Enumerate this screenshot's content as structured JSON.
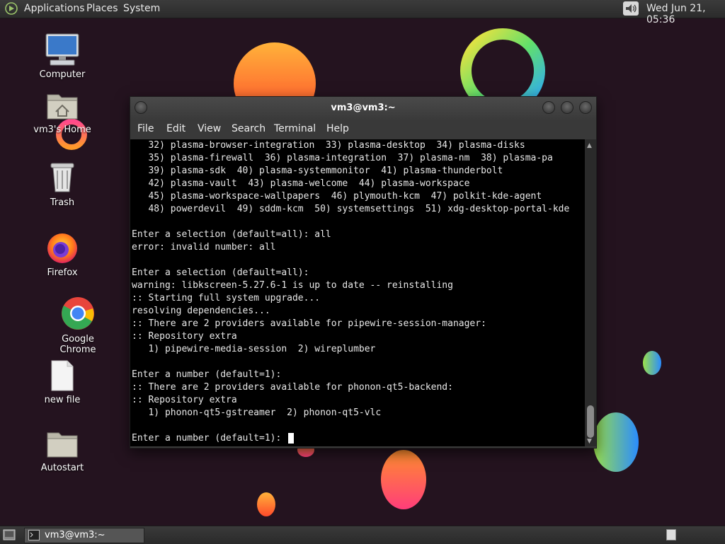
{
  "top_panel": {
    "menus": [
      "Applications",
      "Places",
      "System"
    ],
    "clock": "Wed Jun 21, 05:36"
  },
  "desktop_icons": [
    {
      "label": "Computer",
      "icon": "computer-icon"
    },
    {
      "label": "vm3's Home",
      "icon": "home-folder-icon"
    },
    {
      "label": "Trash",
      "icon": "trash-icon"
    },
    {
      "label": "Firefox",
      "icon": "firefox-icon"
    },
    {
      "label": "Google Chrome",
      "icon": "chrome-icon"
    },
    {
      "label": "new file",
      "icon": "file-icon"
    },
    {
      "label": "Autostart",
      "icon": "folder-icon"
    }
  ],
  "terminal": {
    "title": "vm3@vm3:~",
    "menu": [
      "File",
      "Edit",
      "View",
      "Search",
      "Terminal",
      "Help"
    ],
    "lines": [
      "   32) plasma-browser-integration  33) plasma-desktop  34) plasma-disks",
      "   35) plasma-firewall  36) plasma-integration  37) plasma-nm  38) plasma-pa",
      "   39) plasma-sdk  40) plasma-systemmonitor  41) plasma-thunderbolt",
      "   42) plasma-vault  43) plasma-welcome  44) plasma-workspace",
      "   45) plasma-workspace-wallpapers  46) plymouth-kcm  47) polkit-kde-agent",
      "   48) powerdevil  49) sddm-kcm  50) systemsettings  51) xdg-desktop-portal-kde",
      "",
      "Enter a selection (default=all): all",
      "error: invalid number: all",
      "",
      "Enter a selection (default=all):",
      "warning: libkscreen-5.27.6-1 is up to date -- reinstalling",
      ":: Starting full system upgrade...",
      "resolving dependencies...",
      ":: There are 2 providers available for pipewire-session-manager:",
      ":: Repository extra",
      "   1) pipewire-media-session  2) wireplumber",
      "",
      "Enter a number (default=1):",
      ":: There are 2 providers available for phonon-qt5-backend:",
      ":: Repository extra",
      "   1) phonon-qt5-gstreamer  2) phonon-qt5-vlc",
      ""
    ],
    "prompt": "Enter a number (default=1): "
  },
  "taskbar": {
    "window_button": "vm3@vm3:~"
  },
  "colors": {
    "desktop_background": "#24131f",
    "terminal_background": "#000000",
    "terminal_text": "#e8e8e8"
  }
}
